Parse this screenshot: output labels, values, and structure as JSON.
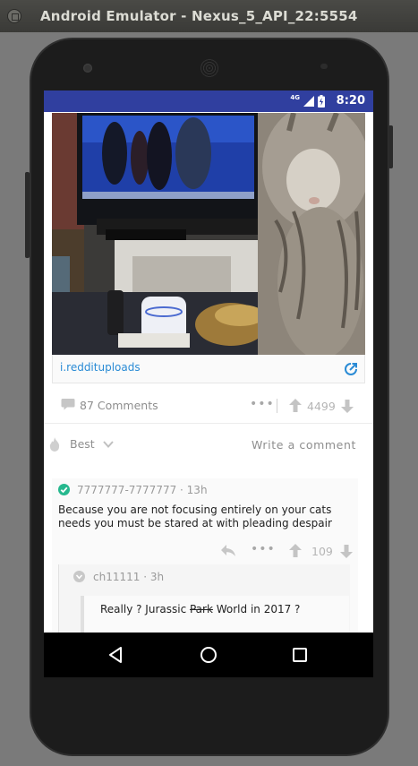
{
  "window": {
    "title": "Android Emulator - Nexus_5_API_22:5554"
  },
  "status_bar": {
    "network": "4G",
    "time": "8:20"
  },
  "post": {
    "link_domain": "i.reddituploads",
    "comments_label": "87 Comments",
    "score": "4499"
  },
  "sort": {
    "label": "Best",
    "write_comment": "Write a comment"
  },
  "comments": [
    {
      "author": "7777777-7777777",
      "age": "13h",
      "body": "Because you are not focusing entirely on your cats needs you must be stared at with pleading despair",
      "score": "109"
    },
    {
      "author": "ch11111",
      "age": "3h",
      "body_before": "Really ? Jurassic ",
      "body_struck": "Park",
      "body_after": " World in 2017 ?"
    }
  ],
  "colors": {
    "status_bar": "#303f9f",
    "link": "#2a8bd5",
    "check_green": "#26b88e",
    "muted_text": "#8e8e8e"
  },
  "icons": [
    "comment-icon",
    "more-dots-icon",
    "upvote-icon",
    "downvote-icon",
    "fire-icon",
    "chevron-down-icon",
    "external-link-icon",
    "check-circle-icon",
    "reply-icon",
    "back-icon",
    "home-icon",
    "recents-icon"
  ]
}
